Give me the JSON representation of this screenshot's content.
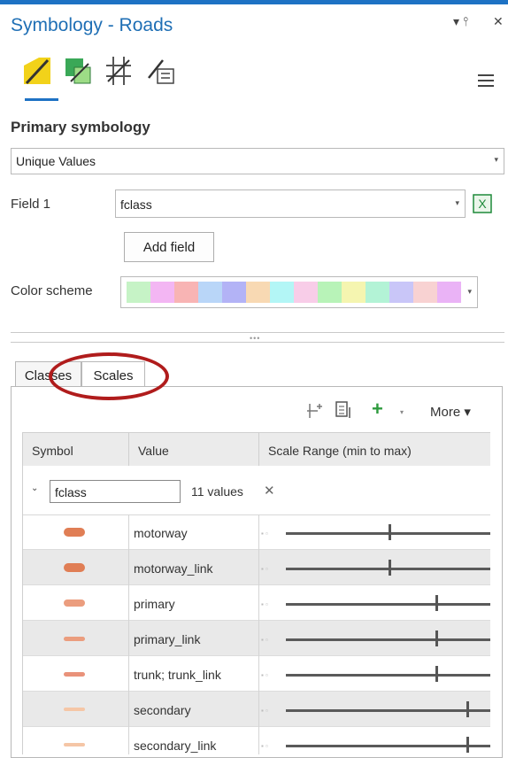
{
  "pane": {
    "title": "Symbology - Roads",
    "pin_glyph": "▾ ⫯",
    "close_glyph": "✕"
  },
  "toolbar": {
    "icons": [
      "primary-symbology-icon",
      "vary-symbology-icon",
      "symbol-layers-icon",
      "labels-icon"
    ],
    "menu_icon": "hamburger-icon"
  },
  "primary": {
    "section_title": "Primary symbology",
    "renderer": "Unique Values",
    "field_label": "Field 1",
    "field_value": "fclass",
    "add_field": "Add field",
    "color_scheme_label": "Color scheme",
    "color_scheme_colors": [
      "#c6f3c6",
      "#f3b6f3",
      "#f8b4b4",
      "#b9d6f8",
      "#b3b3f6",
      "#f8d9b3",
      "#b3f6f6",
      "#f8cde8",
      "#b8f3b8",
      "#f5f5b0",
      "#b3f3d6",
      "#c9c6f8",
      "#f8d2d2",
      "#eab3f6"
    ]
  },
  "tabs": [
    {
      "label": "Classes",
      "active": false
    },
    {
      "label": "Scales",
      "active": true
    }
  ],
  "panel_toolbar": {
    "more": "More"
  },
  "grid": {
    "columns": [
      "Symbol",
      "Value",
      "Scale Range (min to max)"
    ],
    "group": {
      "field": "fclass",
      "count_label": "11 values"
    },
    "rows": [
      {
        "value": "motorway",
        "color": "#e07e55",
        "thick": 10,
        "scale": 0.5
      },
      {
        "value": "motorway_link",
        "color": "#e07e55",
        "thick": 10,
        "scale": 0.5
      },
      {
        "value": "primary",
        "color": "#eb9d7e",
        "thick": 8,
        "scale": 0.73
      },
      {
        "value": "primary_link",
        "color": "#eb9d7e",
        "thick": 5,
        "scale": 0.73
      },
      {
        "value": "trunk; trunk_link",
        "color": "#e9927a",
        "thick": 5,
        "scale": 0.73
      },
      {
        "value": "secondary",
        "color": "#f5c6a6",
        "thick": 4,
        "scale": 0.88
      },
      {
        "value": "secondary_link",
        "color": "#f5c6a6",
        "thick": 4,
        "scale": 0.88
      }
    ]
  },
  "colors": {
    "accent": "#1e72c4",
    "annotation_circle": "#b01c1c"
  }
}
